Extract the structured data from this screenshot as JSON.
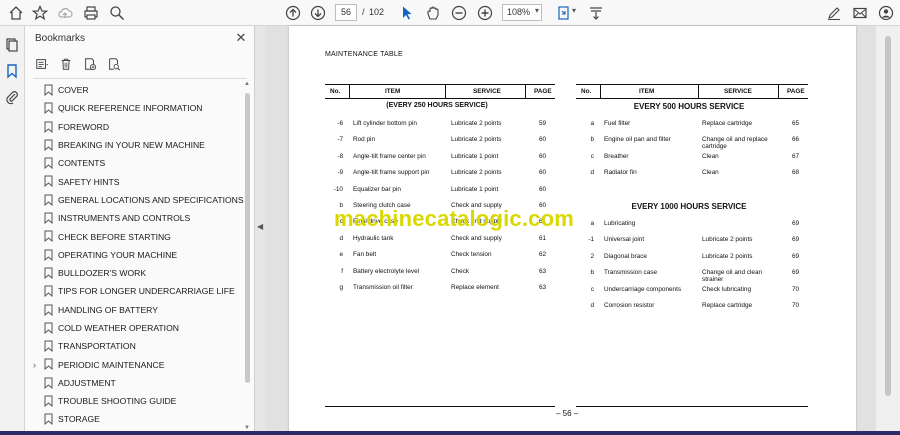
{
  "toolbar": {
    "current_page": "56",
    "page_separator": "/",
    "total_pages": "102",
    "zoom": "108%"
  },
  "bookmarks": {
    "title": "Bookmarks",
    "items": [
      {
        "label": "COVER",
        "expandable": false
      },
      {
        "label": "QUICK REFERENCE INFORMATION",
        "expandable": false
      },
      {
        "label": "FOREWORD",
        "expandable": false
      },
      {
        "label": "BREAKING IN YOUR NEW MACHINE",
        "expandable": false
      },
      {
        "label": "CONTENTS",
        "expandable": false
      },
      {
        "label": "SAFETY HINTS",
        "expandable": false
      },
      {
        "label": "GENERAL LOCATIONS AND SPECIFICATIONS",
        "expandable": false
      },
      {
        "label": "INSTRUMENTS AND CONTROLS",
        "expandable": false
      },
      {
        "label": "CHECK BEFORE STARTING",
        "expandable": false
      },
      {
        "label": "OPERATING YOUR MACHINE",
        "expandable": false
      },
      {
        "label": "BULLDOZER'S WORK",
        "expandable": false
      },
      {
        "label": "TIPS FOR LONGER UNDERCARRIAGE LIFE",
        "expandable": false
      },
      {
        "label": "HANDLING OF BATTERY",
        "expandable": false
      },
      {
        "label": "COLD WEATHER OPERATION",
        "expandable": false
      },
      {
        "label": "TRANSPORTATION",
        "expandable": false
      },
      {
        "label": "PERIODIC MAINTENANCE",
        "expandable": true
      },
      {
        "label": "ADJUSTMENT",
        "expandable": false
      },
      {
        "label": "TROUBLE SHOOTING GUIDE",
        "expandable": false
      },
      {
        "label": "STORAGE",
        "expandable": false
      }
    ]
  },
  "document": {
    "title": "MAINTENANCE TABLE",
    "headers": {
      "no": "No.",
      "item": "ITEM",
      "service": "SERVICE",
      "page": "PAGE"
    },
    "left_section": "(EVERY 250 HOURS SERVICE)",
    "left_rows": [
      {
        "no": "-6",
        "item": "Lift cylinder bottom pin",
        "service": "Lubricate 2 points",
        "page": "59"
      },
      {
        "no": "-7",
        "item": "Rod pin",
        "service": "Lubricate 2 points",
        "page": "60"
      },
      {
        "no": "-8",
        "item": "Angle-tilt frame center pin",
        "service": "Lubricate 1 point",
        "page": "60"
      },
      {
        "no": "-9",
        "item": "Angle-tilt frame support pin",
        "service": "Lubricate 2 points",
        "page": "60"
      },
      {
        "no": "-10",
        "item": "Equalizer bar pin",
        "service": "Lubricate 1 point",
        "page": "60"
      },
      {
        "no": "b",
        "item": "Steering clutch case",
        "service": "Check and supply",
        "page": "60"
      },
      {
        "no": "c",
        "item": "Final drive case",
        "service": "Check and supply",
        "page": "61"
      },
      {
        "no": "d",
        "item": "Hydraulic tank",
        "service": "Check and supply",
        "page": "61"
      },
      {
        "no": "e",
        "item": "Fan belt",
        "service": "Check tension",
        "page": "62"
      },
      {
        "no": "f",
        "item": "Battery electrolyte level",
        "service": "Check",
        "page": "63"
      },
      {
        "no": "g",
        "item": "Transmission oil filter",
        "service": "Replace element",
        "page": "63"
      }
    ],
    "right_section_1": "EVERY 500 HOURS SERVICE",
    "right_rows_1": [
      {
        "no": "a",
        "item": "Fuel filter",
        "service": "Replace cartridge",
        "page": "65"
      },
      {
        "no": "b",
        "item": "Engine oil pan and filter",
        "service": "Change oil and replace cartridge",
        "page": "66"
      },
      {
        "no": "c",
        "item": "Breather",
        "service": "Clean",
        "page": "67"
      },
      {
        "no": "d",
        "item": "Radiator fin",
        "service": "Clean",
        "page": "68"
      }
    ],
    "right_section_2": "EVERY 1000 HOURS SERVICE",
    "right_rows_2": [
      {
        "no": "a",
        "item": "Lubricating",
        "service": "",
        "page": "69"
      },
      {
        "no": "-1",
        "item": "Universal joint",
        "service": "Lubricate 2 points",
        "page": "69"
      },
      {
        "no": "2",
        "item": "Diagonal brace",
        "service": "Lubricate 2 points",
        "page": "69"
      },
      {
        "no": "b",
        "item": "Transmission case",
        "service": "Change oil and clean strainer",
        "page": "69"
      },
      {
        "no": "c",
        "item": "Undercarriage components",
        "service": "Check lubricating",
        "page": "70"
      },
      {
        "no": "d",
        "item": "Corrosion resistor",
        "service": "Replace cartridge",
        "page": "70"
      }
    ],
    "watermark": "machinecatalogic.com",
    "page_number": "– 56 –"
  }
}
